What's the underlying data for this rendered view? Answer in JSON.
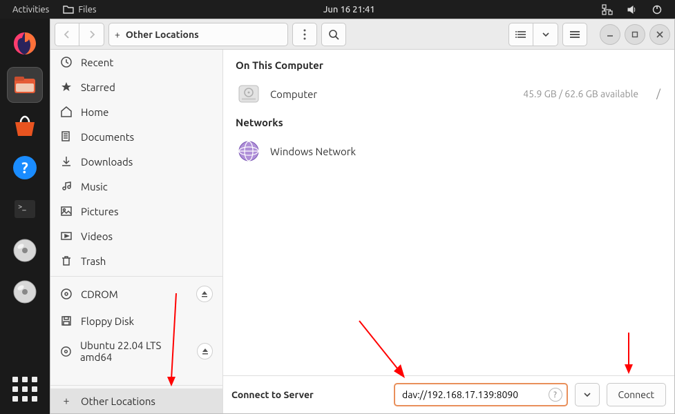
{
  "panel": {
    "activities": "Activities",
    "app_label": "Files",
    "clock": "Jun 16  21:41"
  },
  "headerbar": {
    "location_label": "Other Locations"
  },
  "sidebar": {
    "recent": "Recent",
    "starred": "Starred",
    "home": "Home",
    "documents": "Documents",
    "downloads": "Downloads",
    "music": "Music",
    "pictures": "Pictures",
    "videos": "Videos",
    "trash": "Trash",
    "cdrom": "CDROM",
    "floppy": "Floppy Disk",
    "ubuntu": "Ubuntu 22.04 LTS amd64",
    "other": "Other Locations"
  },
  "content": {
    "on_this_computer": "On This Computer",
    "computer_label": "Computer",
    "computer_meta": "45.9 GB / 62.6 GB available",
    "computer_mount": "/",
    "networks": "Networks",
    "windows_network": "Windows Network"
  },
  "footer": {
    "label": "Connect to Server",
    "address": "dav://192.168.17.139:8090",
    "connect": "Connect"
  }
}
